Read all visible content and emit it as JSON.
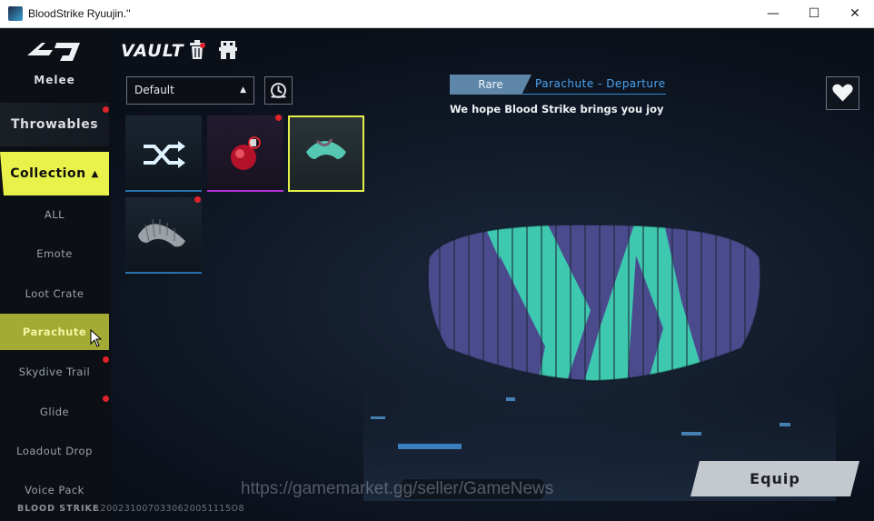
{
  "window": {
    "title": "BloodStrike Ryuujin.''",
    "minimize_glyph": "—",
    "maximize_glyph": "☐",
    "close_glyph": "✕"
  },
  "sidebar": {
    "top_label": "Melee",
    "categories": [
      {
        "label": "Throwables",
        "has_notification": true
      },
      {
        "label": "Collection",
        "expanded": true,
        "arrow": "▲"
      }
    ],
    "subitems": [
      {
        "label": "ALL",
        "active": false,
        "has_notification": false
      },
      {
        "label": "Emote",
        "active": false,
        "has_notification": false
      },
      {
        "label": "Loot Crate",
        "active": false,
        "has_notification": false
      },
      {
        "label": "Parachute",
        "active": true,
        "has_notification": false
      },
      {
        "label": "Skydive Trail",
        "active": false,
        "has_notification": true
      },
      {
        "label": "Glide",
        "active": false,
        "has_notification": true
      },
      {
        "label": "Loadout Drop",
        "active": false,
        "has_notification": false
      },
      {
        "label": "Voice Pack",
        "active": false,
        "has_notification": false
      }
    ]
  },
  "header": {
    "title": "VAULT",
    "icons": [
      "trash-icon",
      "store-icon"
    ]
  },
  "filter": {
    "selected": "Default",
    "arrow": "▲"
  },
  "items": [
    {
      "icon": "random-shuffle-icon",
      "rarity_color": "#2a6fa8",
      "selected": false,
      "has_notification": false
    },
    {
      "icon": "red-ornament-icon",
      "rarity_color": "#b12fd0",
      "selected": false,
      "has_notification": true
    },
    {
      "icon": "teal-parachute-icon",
      "rarity_color": "#e4ee4a",
      "selected": true,
      "has_notification": false
    },
    {
      "icon": "grey-parachute-icon",
      "rarity_color": "#2a6fa8",
      "selected": false,
      "has_notification": true
    }
  ],
  "item_info": {
    "rarity": "Rare",
    "name": "Parachute - Departure",
    "description": "We hope Blood Strike brings you joy"
  },
  "actions": {
    "equip_label": "Equip"
  },
  "footer": {
    "brand": "BLOOD STRIKE",
    "id": "12002310070330620051115O8"
  },
  "watermark": "https://gamemarket.gg/seller/GameNews",
  "colors": {
    "accent_yellow": "#e8f24a",
    "active_sub": "#a3ab35",
    "rarity_blue": "#5e86a8",
    "link_blue": "#4aa3ef",
    "notification_red": "#e0222a",
    "parachute_teal": "#3ec8b0",
    "parachute_purple": "#4a4a8c"
  }
}
